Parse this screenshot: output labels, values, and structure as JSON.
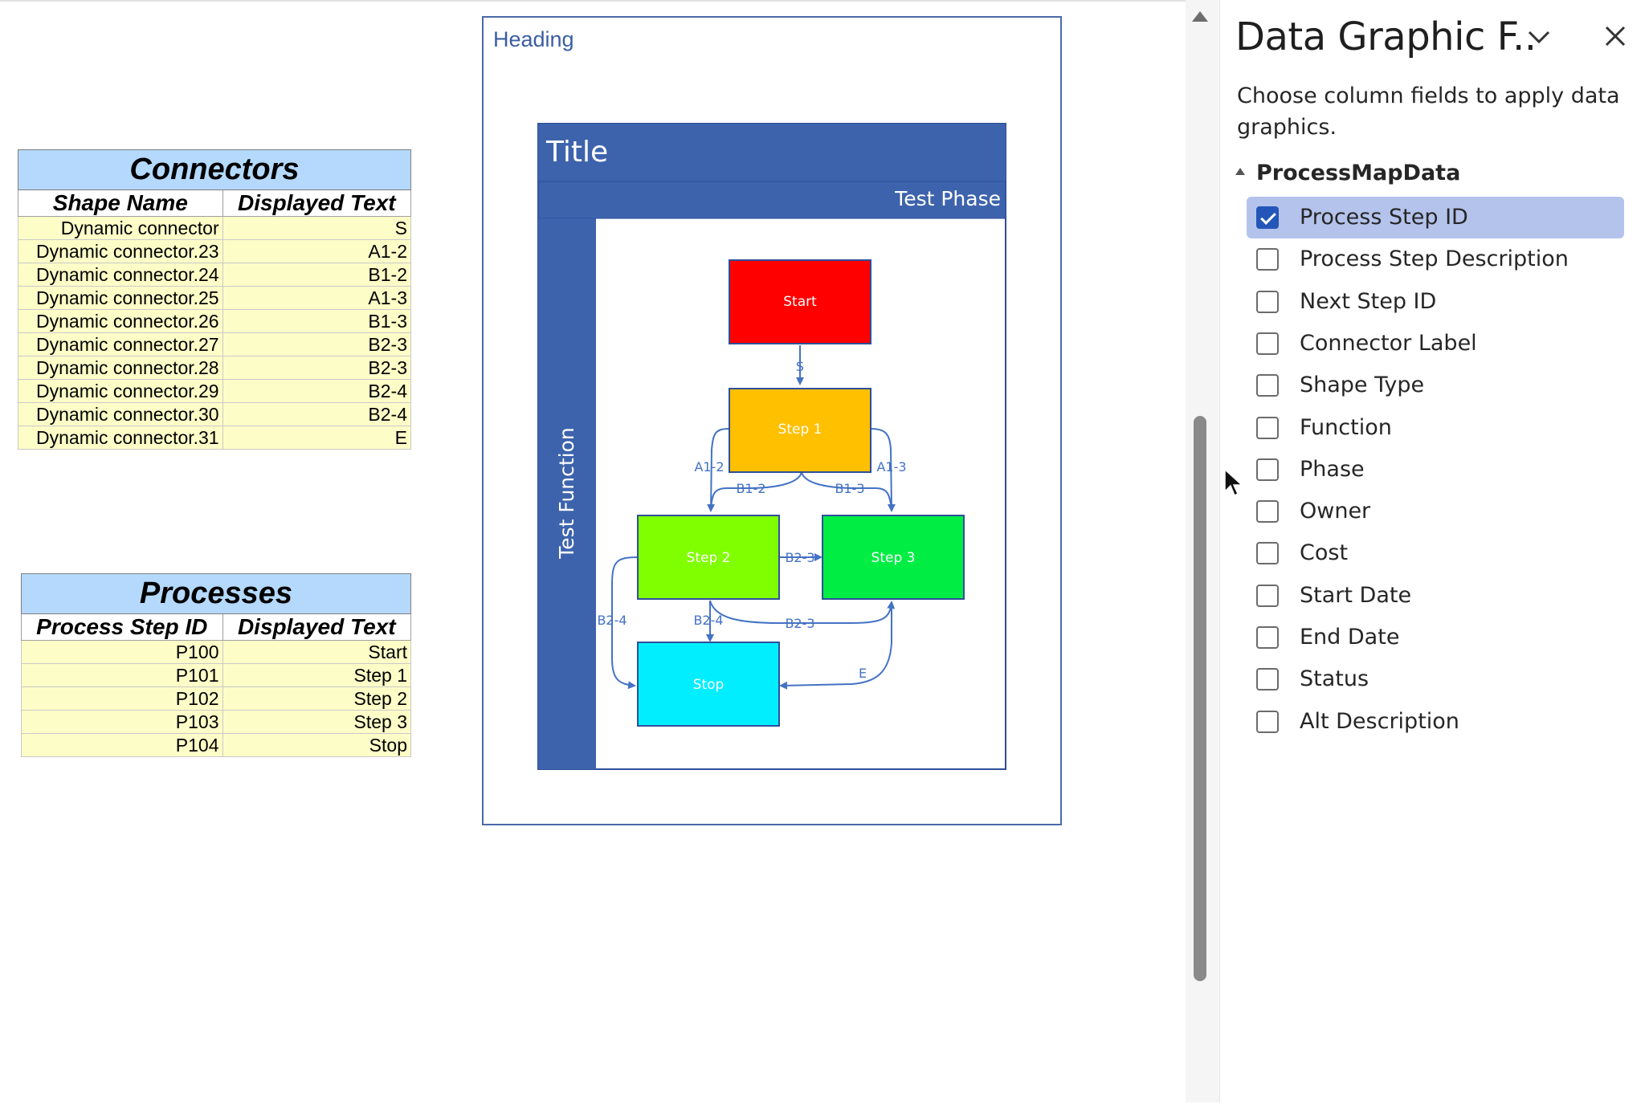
{
  "connectors_table": {
    "caption": "Connectors",
    "headers": [
      "Shape Name",
      "Displayed Text"
    ],
    "rows": [
      [
        "Dynamic connector",
        "S"
      ],
      [
        "Dynamic connector.23",
        "A1-2"
      ],
      [
        "Dynamic connector.24",
        "B1-2"
      ],
      [
        "Dynamic connector.25",
        "A1-3"
      ],
      [
        "Dynamic connector.26",
        "B1-3"
      ],
      [
        "Dynamic connector.27",
        "B2-3"
      ],
      [
        "Dynamic connector.28",
        "B2-3"
      ],
      [
        "Dynamic connector.29",
        "B2-4"
      ],
      [
        "Dynamic connector.30",
        "B2-4"
      ],
      [
        "Dynamic connector.31",
        "E"
      ]
    ]
  },
  "processes_table": {
    "caption": "Processes",
    "headers": [
      "Process Step ID",
      "Displayed Text"
    ],
    "rows": [
      [
        "P100",
        "Start"
      ],
      [
        "P101",
        "Step 1"
      ],
      [
        "P102",
        "Step 2"
      ],
      [
        "P103",
        "Step 3"
      ],
      [
        "P104",
        "Stop"
      ]
    ]
  },
  "diagram": {
    "heading": "Heading",
    "title": "Title",
    "phase": "Test Phase",
    "function": "Test Function",
    "shapes": {
      "start": "Start",
      "step1": "Step 1",
      "step2": "Step 2",
      "step3": "Step 3",
      "stop": "Stop"
    },
    "connector_labels": {
      "s": "S",
      "a12": "A1-2",
      "a13": "A1-3",
      "b12": "B1-2",
      "b13": "B1-3",
      "b23a": "B2-3",
      "b23b": "B2-3",
      "b24a": "B2-4",
      "b24b": "B2-4",
      "e": "E"
    },
    "colors": {
      "start": "#ff0000",
      "step1": "#ffc000",
      "step2": "#80ff00",
      "step3": "#00ee44",
      "stop": "#00eeff",
      "swimlane": "#3e63ad",
      "connector": "#4472c4"
    }
  },
  "panel": {
    "title": "Data Graphic F..",
    "description": "Choose column fields to apply data graphics.",
    "group": "ProcessMapData",
    "fields": [
      {
        "label": "Process Step ID",
        "checked": true
      },
      {
        "label": "Process Step Description",
        "checked": false
      },
      {
        "label": "Next Step ID",
        "checked": false
      },
      {
        "label": "Connector Label",
        "checked": false
      },
      {
        "label": "Shape Type",
        "checked": false
      },
      {
        "label": "Function",
        "checked": false
      },
      {
        "label": "Phase",
        "checked": false
      },
      {
        "label": "Owner",
        "checked": false
      },
      {
        "label": "Cost",
        "checked": false
      },
      {
        "label": "Start Date",
        "checked": false
      },
      {
        "label": "End Date",
        "checked": false
      },
      {
        "label": "Status",
        "checked": false
      },
      {
        "label": "Alt Description",
        "checked": false
      }
    ]
  }
}
